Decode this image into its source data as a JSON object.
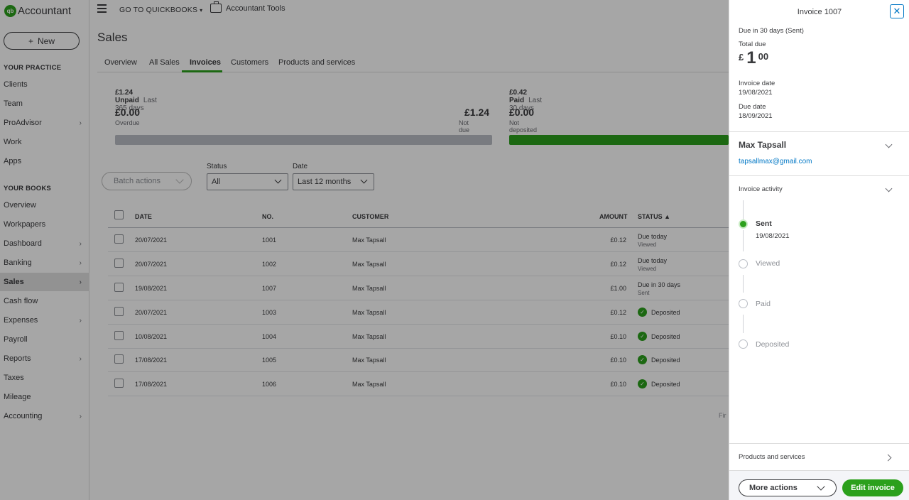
{
  "app": {
    "logo_mark": "qb",
    "name": "Accountant",
    "new_label": "New",
    "new_icon": "+"
  },
  "sidebar": {
    "practice_heading": "YOUR PRACTICE",
    "practice_items": [
      {
        "label": "Clients",
        "chevron": false
      },
      {
        "label": "Team",
        "chevron": false
      },
      {
        "label": "ProAdvisor",
        "chevron": true
      },
      {
        "label": "Work",
        "chevron": false
      },
      {
        "label": "Apps",
        "chevron": false
      }
    ],
    "books_heading": "YOUR BOOKS",
    "books_items": [
      {
        "label": "Overview",
        "chevron": false
      },
      {
        "label": "Workpapers",
        "chevron": false
      },
      {
        "label": "Dashboard",
        "chevron": true
      },
      {
        "label": "Banking",
        "chevron": true
      },
      {
        "label": "Sales",
        "chevron": true,
        "active": true
      },
      {
        "label": "Cash flow",
        "chevron": false
      },
      {
        "label": "Expenses",
        "chevron": true
      },
      {
        "label": "Payroll",
        "chevron": false
      },
      {
        "label": "Reports",
        "chevron": true
      },
      {
        "label": "Taxes",
        "chevron": false
      },
      {
        "label": "Mileage",
        "chevron": false
      },
      {
        "label": "Accounting",
        "chevron": true
      }
    ]
  },
  "topbar": {
    "goto_label": "GO TO QUICKBOOKS",
    "tools_label": "Accountant Tools"
  },
  "page": {
    "title": "Sales",
    "tabs": [
      "Overview",
      "All Sales",
      "Invoices",
      "Customers",
      "Products and services"
    ],
    "active_tab": "Invoices"
  },
  "money_bar": {
    "unpaid_amount": "£1.24 Unpaid",
    "unpaid_period": "Last 365 days",
    "overdue_amount": "£0.00",
    "overdue_label": "Overdue",
    "notdue_amount": "£1.24",
    "notdue_label": "Not due yet",
    "paid_amount": "£0.42 Paid",
    "paid_period": "Last 30 days",
    "notdeposited_amount": "£0.00",
    "notdeposited_label": "Not deposited",
    "colors": {
      "unpaid_bar": "#babec5",
      "paid_bar": "#2ca01c"
    }
  },
  "filters": {
    "batch_label": "Batch actions",
    "status_label": "Status",
    "status_value": "All",
    "date_label": "Date",
    "date_value": "Last 12 months"
  },
  "table": {
    "headers": {
      "date": "DATE",
      "no": "NO.",
      "customer": "CUSTOMER",
      "amount": "AMOUNT",
      "status": "STATUS ▲"
    },
    "rows": [
      {
        "date": "20/07/2021",
        "no": "1001",
        "customer": "Max Tapsall",
        "amount": "£0.12",
        "status": "Due today",
        "substatus": "Viewed",
        "deposited": false
      },
      {
        "date": "20/07/2021",
        "no": "1002",
        "customer": "Max Tapsall",
        "amount": "£0.12",
        "status": "Due today",
        "substatus": "Viewed",
        "deposited": false
      },
      {
        "date": "19/08/2021",
        "no": "1007",
        "customer": "Max Tapsall",
        "amount": "£1.00",
        "status": "Due in 30 days",
        "substatus": "Sent",
        "deposited": false
      },
      {
        "date": "20/07/2021",
        "no": "1003",
        "customer": "Max Tapsall",
        "amount": "£0.12",
        "status": "Deposited",
        "substatus": "",
        "deposited": true
      },
      {
        "date": "10/08/2021",
        "no": "1004",
        "customer": "Max Tapsall",
        "amount": "£0.10",
        "status": "Deposited",
        "substatus": "",
        "deposited": true
      },
      {
        "date": "17/08/2021",
        "no": "1005",
        "customer": "Max Tapsall",
        "amount": "£0.10",
        "status": "Deposited",
        "substatus": "",
        "deposited": true
      },
      {
        "date": "17/08/2021",
        "no": "1006",
        "customer": "Max Tapsall",
        "amount": "£0.10",
        "status": "Deposited",
        "substatus": "",
        "deposited": true
      }
    ],
    "pager_text": "Fir"
  },
  "drawer": {
    "title": "Invoice 1007",
    "close_icon": "✕",
    "due_status": "Due in 30 days (Sent)",
    "total_due_label": "Total due",
    "total_currency": "£",
    "total_whole": "1",
    "total_fraction": "00",
    "invoice_date_label": "Invoice date",
    "invoice_date": "19/08/2021",
    "due_date_label": "Due date",
    "due_date": "18/09/2021",
    "customer_name": "Max Tapsall",
    "customer_email": "tapsallmax@gmail.com",
    "activity_label": "Invoice activity",
    "activity": [
      {
        "label": "Sent",
        "done": true
      },
      {
        "label": "Viewed",
        "done": false
      },
      {
        "label": "Paid",
        "done": false
      },
      {
        "label": "Deposited",
        "done": false
      }
    ],
    "sent_date": "19/08/2021",
    "products_label": "Products and services",
    "more_actions_label": "More actions",
    "edit_label": "Edit invoice"
  },
  "colors": {
    "brand_green": "#2ca01c",
    "link_blue": "#0077c5",
    "text": "#393a3d"
  }
}
